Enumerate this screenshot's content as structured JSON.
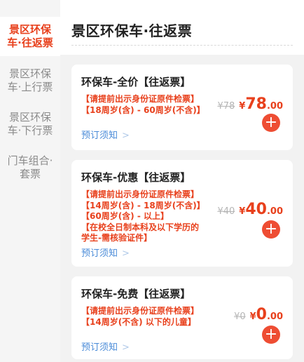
{
  "sidebar": {
    "items": [
      {
        "line1": "景区环保",
        "line2": "车·往返票",
        "active": true
      },
      {
        "line1": "景区环保",
        "line2": "车·上行票",
        "active": false
      },
      {
        "line1": "景区环保",
        "line2": "车·下行票",
        "active": false
      },
      {
        "line1": "门车组合·",
        "line2": "套票",
        "active": false
      }
    ]
  },
  "main": {
    "title": "景区环保车·往返票"
  },
  "tickets": [
    {
      "title": "环保车-全价【往返票】",
      "notes": [
        "【请提前出示身份证原件检票】",
        "【18周岁(含) - 60周岁(不含)】"
      ],
      "original_price": "¥78",
      "price_symbol": "¥",
      "price_integer": "78",
      "price_decimal": ".00",
      "notice_label": "预订须知",
      "add_icon": "plus-icon"
    },
    {
      "title": "环保车-优惠【往返票】",
      "notes": [
        "【请提前出示身份证原件检票】",
        "【14周岁(含) - 18周岁(不含)】",
        "【60周岁(含) - 以上】",
        "【在校全日制本科及以下学历的",
        "学生-需核验证件】"
      ],
      "original_price": "¥40",
      "price_symbol": "¥",
      "price_integer": "40",
      "price_decimal": ".00",
      "notice_label": "预订须知",
      "add_icon": "plus-icon"
    },
    {
      "title": "环保车-免费【往返票】",
      "notes": [
        "【请提前出示身份证原件检票】",
        "【14周岁(不含) 以下的儿童】"
      ],
      "original_price": "¥0",
      "price_symbol": "¥",
      "price_integer": "0",
      "price_decimal": ".00",
      "notice_label": "预订须知",
      "add_icon": "plus-icon"
    }
  ],
  "colors": {
    "accent": "#e8401c",
    "link": "#4a8bd8",
    "add_button": "#ee4d33"
  }
}
